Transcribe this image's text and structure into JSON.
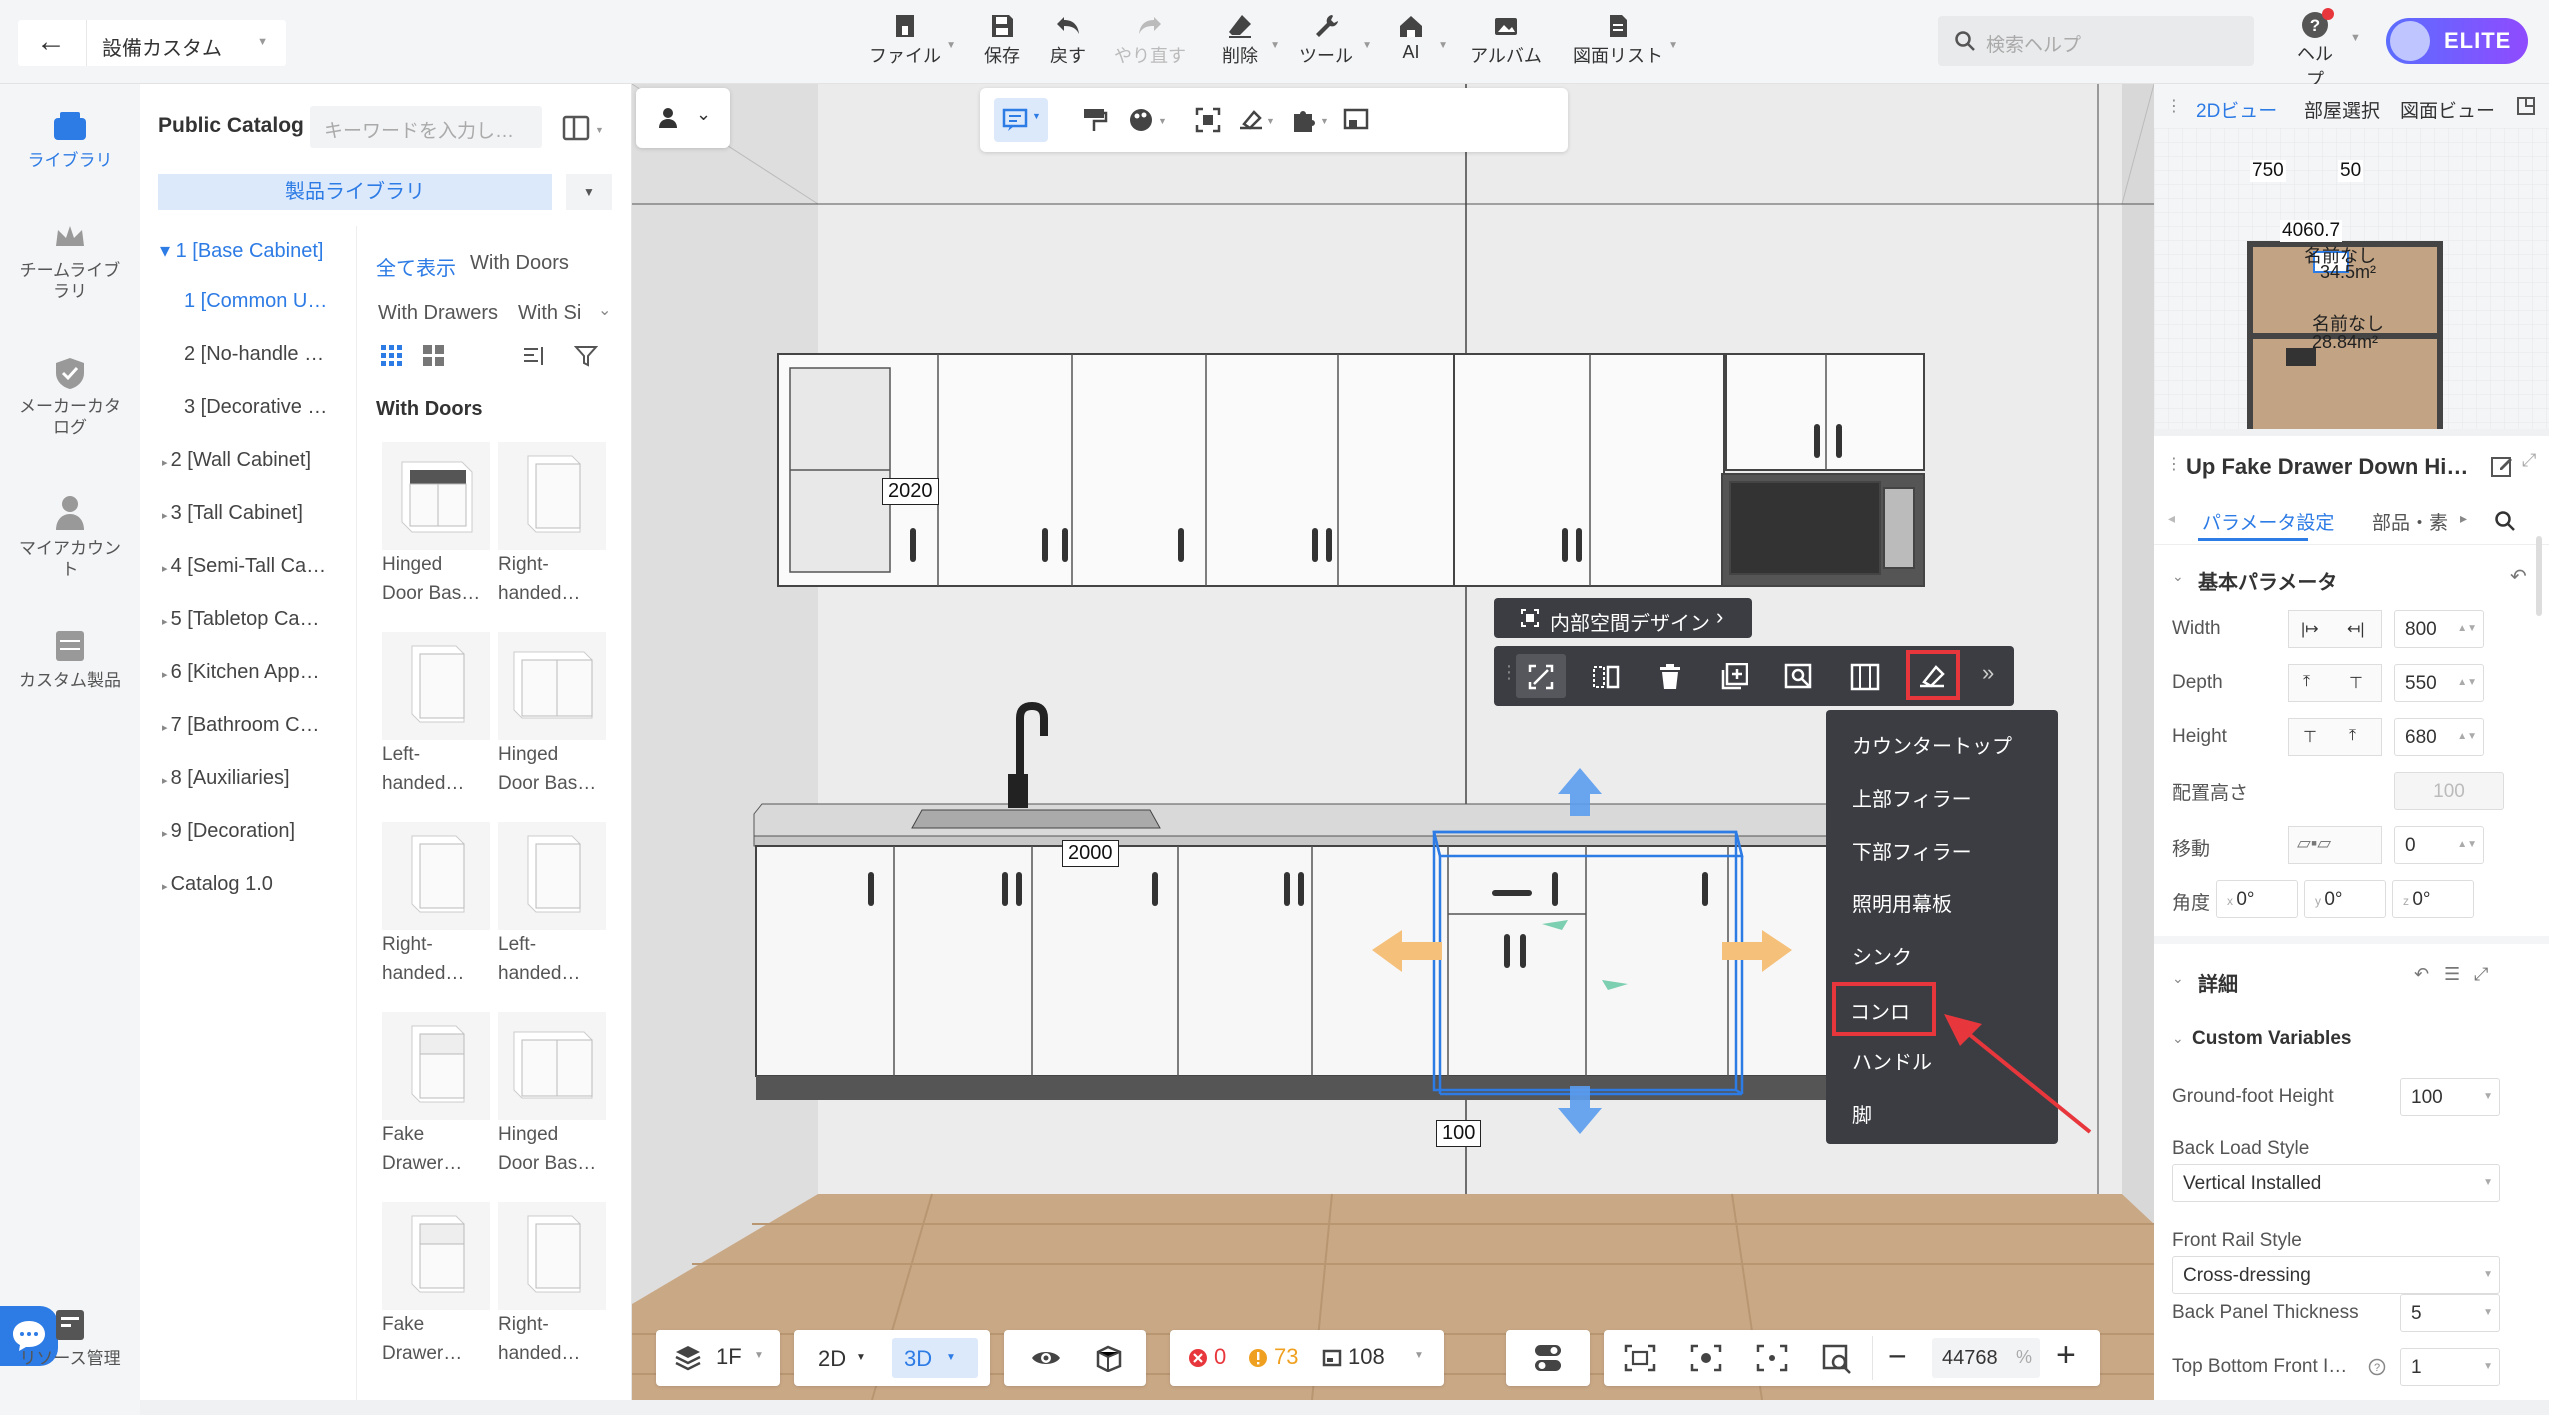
{
  "header": {
    "back_title": "設備カスタム",
    "search_placeholder": "検索ヘルプ",
    "help_label": "ヘルプ",
    "plan_label": "ELITE",
    "tools": [
      {
        "label": "ファイル"
      },
      {
        "label": "保存"
      },
      {
        "label": "戻す"
      },
      {
        "label": "やり直す"
      },
      {
        "label": "削除"
      },
      {
        "label": "ツール"
      },
      {
        "label": "AI"
      },
      {
        "label": "アルバム"
      },
      {
        "label": "図面リスト"
      }
    ]
  },
  "left_nav": [
    {
      "label": "ライブラリ"
    },
    {
      "label": "チームライブラリ"
    },
    {
      "label": "メーカーカタログ"
    },
    {
      "label": "マイアカウント"
    },
    {
      "label": "カスタム製品"
    },
    {
      "label": "リソース管理"
    }
  ],
  "catalog": {
    "title": "Public Catalog",
    "keyword_placeholder": "キーワードを入力し…",
    "product_library": "製品ライブラリ",
    "tree": [
      "1 [Base Cabinet]",
      "1 [Common U…",
      "2 [No-handle …",
      "3 [Decorative …",
      "2 [Wall Cabinet]",
      "3 [Tall Cabinet]",
      "4 [Semi-Tall Ca…",
      "5 [Tabletop Ca…",
      "6 [Kitchen App…",
      "7 [Bathroom C…",
      "8 [Auxiliaries]",
      "9 [Decoration]",
      "Catalog 1.0"
    ],
    "filters": [
      "全て表示",
      "With Doors",
      "With Drawers",
      "With Si"
    ],
    "section": "With Doors",
    "items": [
      {
        "line1": "Hinged",
        "line2": "Door Bas…"
      },
      {
        "line1": "Right-",
        "line2": "handed…"
      },
      {
        "line1": "Left-",
        "line2": "handed…"
      },
      {
        "line1": "Hinged",
        "line2": "Door Bas…"
      },
      {
        "line1": "Right-",
        "line2": "handed…"
      },
      {
        "line1": "Left-",
        "line2": "handed…"
      },
      {
        "line1": "Fake",
        "line2": "Drawer…"
      },
      {
        "line1": "Hinged",
        "line2": "Door Bas…"
      },
      {
        "line1": "Fake",
        "line2": "Drawer…"
      },
      {
        "line1": "Right-",
        "line2": "handed…"
      }
    ]
  },
  "viewport": {
    "dims": [
      "2020",
      "2000",
      "100"
    ],
    "inner_design": "内部空間デザイン",
    "menu": [
      "カウンタートップ",
      "上部フィラー",
      "下部フィラー",
      "照明用幕板",
      "シンク",
      "コンロ",
      "ハンドル",
      "脚"
    ],
    "highlighted_menu": "コンロ"
  },
  "bottom_bar": {
    "floor": "1F",
    "mode2d": "2D",
    "mode3d": "3D",
    "errors": "0",
    "warnings": "73",
    "count": "108",
    "zoom": "44768",
    "zoom_unit": "%"
  },
  "minimap": {
    "tabs": [
      "2Dビュー",
      "部屋選択",
      "図面ビュー"
    ],
    "dims": [
      "750",
      "50",
      "4060.7"
    ],
    "rooms": [
      {
        "name": "名前なし",
        "area": "34.5m²"
      },
      {
        "name": "名前なし",
        "area": "28.84m²"
      }
    ]
  },
  "params": {
    "title": "Up Fake Drawer Down Hi…",
    "tabs": [
      "パラメータ設定",
      "部品・素"
    ],
    "basic": "基本パラメータ",
    "rows": [
      {
        "label": "Width",
        "value": "800"
      },
      {
        "label": "Depth",
        "value": "550"
      },
      {
        "label": "Height",
        "value": "680"
      },
      {
        "label": "配置高さ",
        "value": "100"
      },
      {
        "label": "移動",
        "value": "0"
      }
    ],
    "angle": {
      "label": "角度",
      "x": "0°",
      "y": "0°",
      "z": "0°"
    },
    "detail": "詳細",
    "custom": "Custom Variables",
    "vars": [
      {
        "label": "Ground-foot Height",
        "value": "100"
      },
      {
        "label": "Back Load Style",
        "value": "Vertical Installed"
      },
      {
        "label": "Front Rail Style",
        "value": "Cross-dressing"
      },
      {
        "label": "Back Panel Thickness",
        "value": "5"
      },
      {
        "label": "Top Bottom Front I…",
        "value": "1"
      }
    ]
  },
  "colors": {
    "accent": "#2d7be5",
    "highlight": "#e8373c",
    "menu_bg": "#3b3d42"
  }
}
